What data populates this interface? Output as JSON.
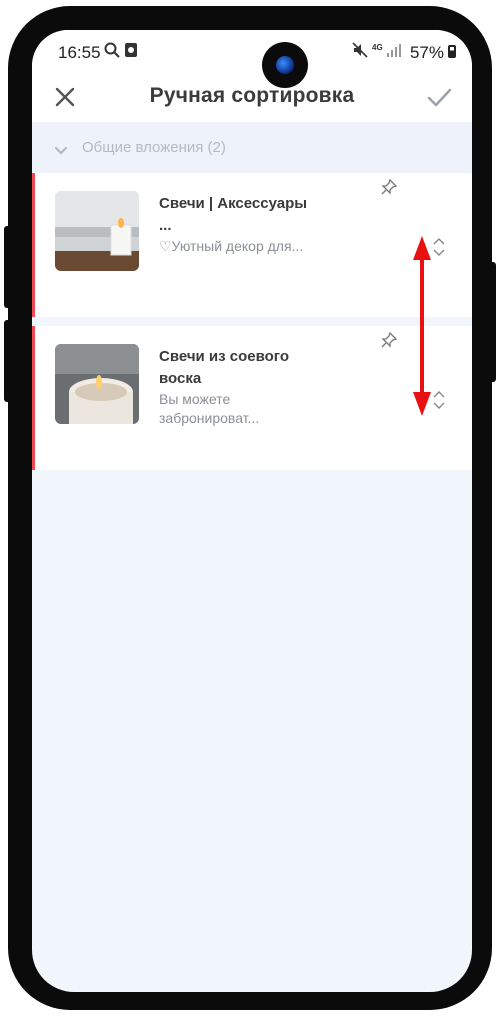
{
  "status_bar": {
    "time": "16:55",
    "battery": "57%",
    "network": "4G"
  },
  "app_bar": {
    "title": "Ручная сортировка",
    "close_icon": "close-icon",
    "confirm_icon": "check-icon"
  },
  "section": {
    "title": "Общие вложения (2)"
  },
  "items": [
    {
      "title": "Свечи | Аксессуары ...",
      "description": "♡Уютный декор для..."
    },
    {
      "title": "Свечи из соевого воска",
      "description": "Вы можете забронироват..."
    }
  ],
  "colors": {
    "accent_red": "#ef4b55",
    "background": "#f1f6fd"
  }
}
